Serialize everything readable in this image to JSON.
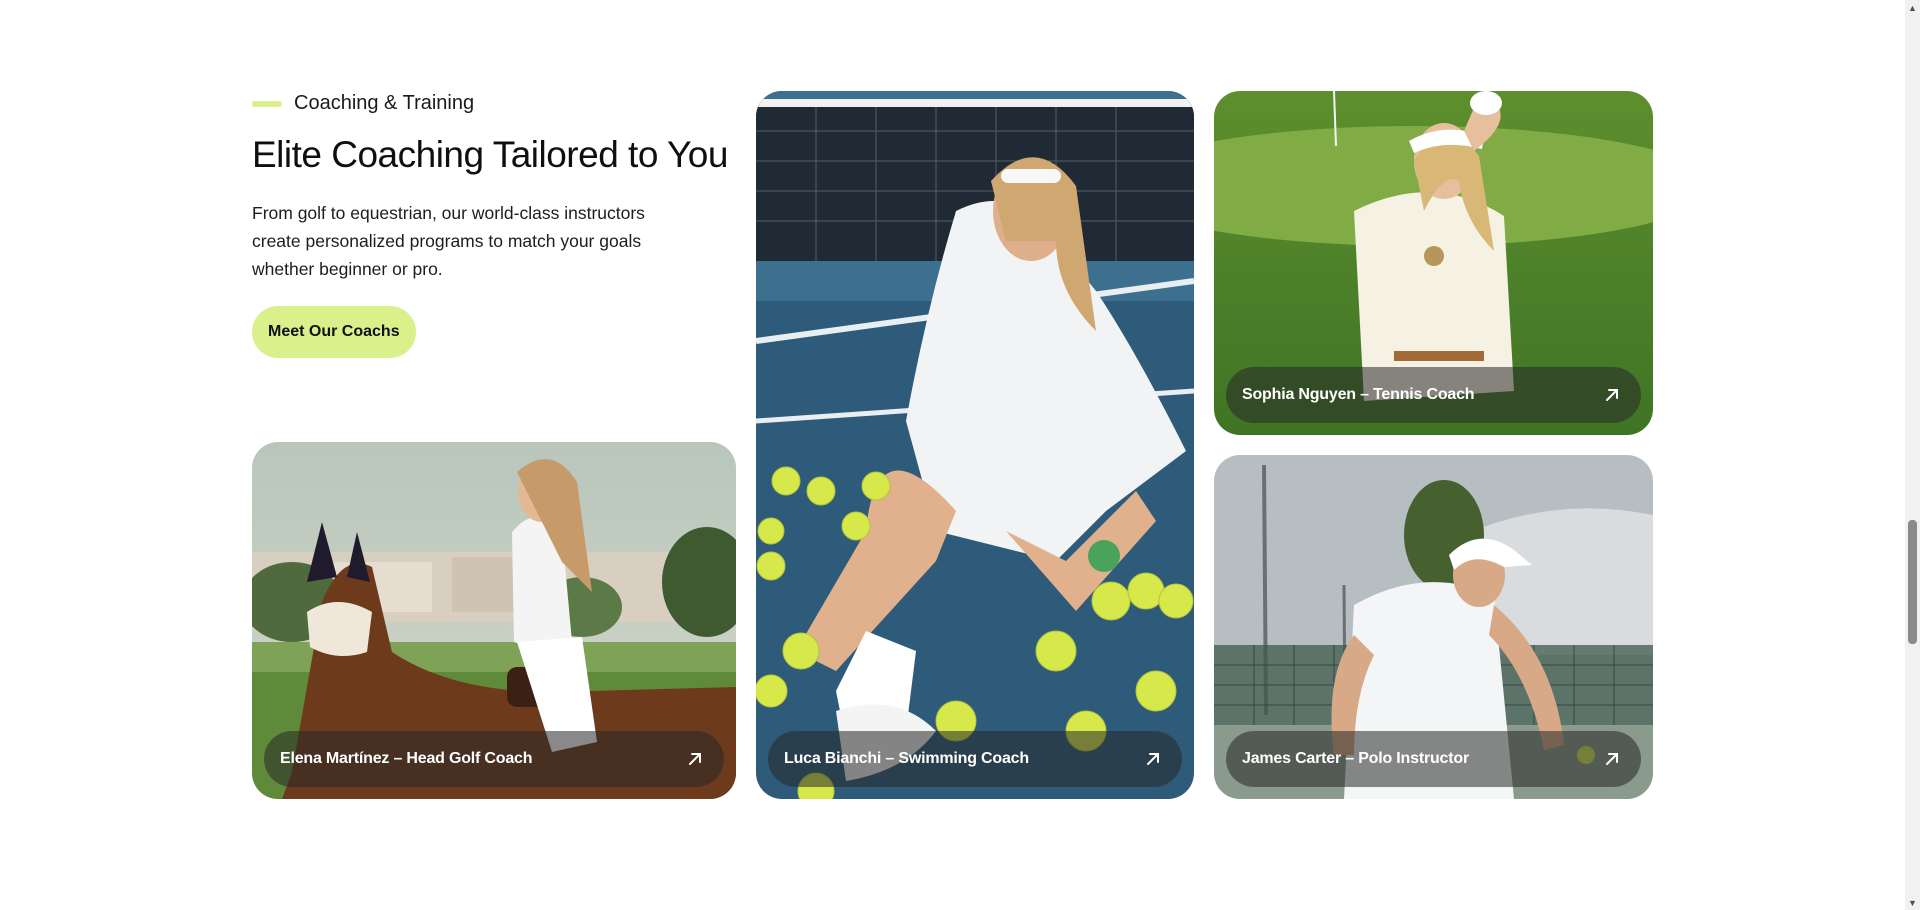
{
  "section": {
    "eyebrow": "Coaching & Training",
    "heading": "Elite Coaching Tailored to You",
    "description": "From golf to equestrian, our world-class instructors create personalized programs to match your goals whether beginner or pro.",
    "cta_label": "Meet Our Coachs"
  },
  "coaches": [
    {
      "name": "Elena Martínez – Head Golf Coach"
    },
    {
      "name": "Luca Bianchi – Swimming Coach"
    },
    {
      "name": "Sophia Nguyen – Tennis Coach"
    },
    {
      "name": "James Carter – Polo Instructor"
    }
  ],
  "colors": {
    "accent": "#d9f08b",
    "caption_bg": "rgba(40,40,40,0.55)"
  },
  "icons": {
    "card_link": "arrow-up-right-icon"
  }
}
